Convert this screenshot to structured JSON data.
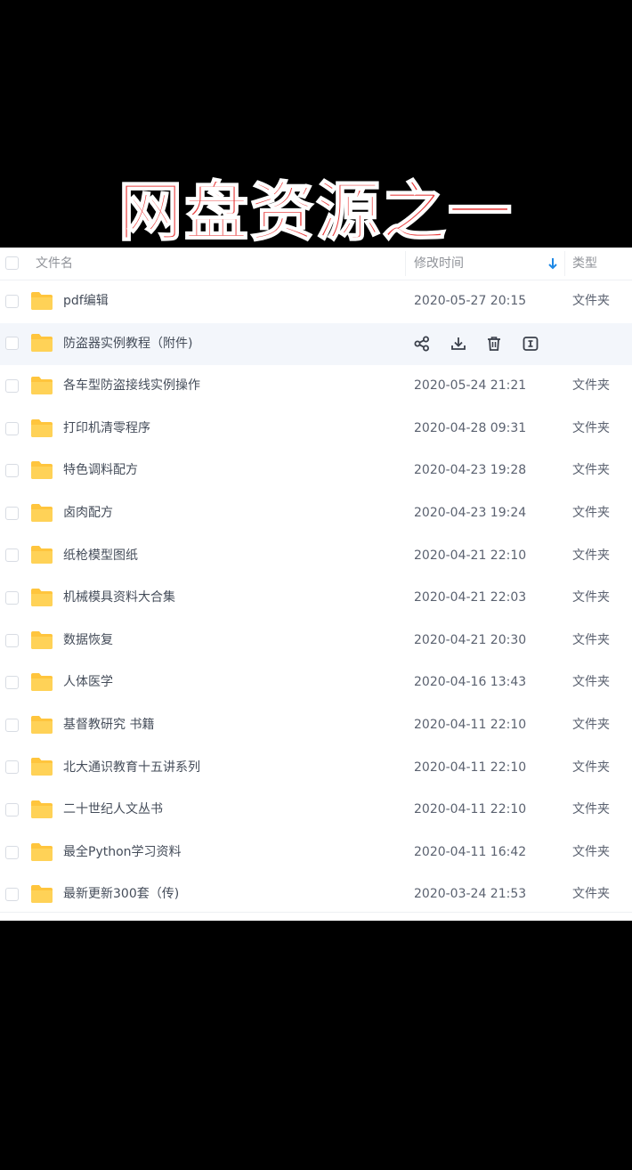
{
  "banner": {
    "title": "网盘资源之一"
  },
  "table": {
    "header": {
      "name": "文件名",
      "time": "修改时间",
      "type": "类型",
      "sort_icon": "arrow-down-icon"
    },
    "rows": [
      {
        "name": "pdf编辑",
        "time": "2020-05-27 20:15",
        "type": "文件夹"
      },
      {
        "name": "防盗器实例教程（附件)",
        "time": "",
        "type": "",
        "hover": true,
        "actions": [
          "share-icon",
          "download-icon",
          "delete-icon",
          "rename-icon"
        ]
      },
      {
        "name": "各车型防盗接线实例操作",
        "time": "2020-05-24 21:21",
        "type": "文件夹"
      },
      {
        "name": "打印机清零程序",
        "time": "2020-04-28 09:31",
        "type": "文件夹"
      },
      {
        "name": "特色调料配方",
        "time": "2020-04-23 19:28",
        "type": "文件夹"
      },
      {
        "name": "卤肉配方",
        "time": "2020-04-23 19:24",
        "type": "文件夹"
      },
      {
        "name": "纸枪模型图纸",
        "time": "2020-04-21 22:10",
        "type": "文件夹"
      },
      {
        "name": "机械模具资料大合集",
        "time": "2020-04-21 22:03",
        "type": "文件夹"
      },
      {
        "name": "数据恢复",
        "time": "2020-04-21 20:30",
        "type": "文件夹"
      },
      {
        "name": "人体医学",
        "time": "2020-04-16 13:43",
        "type": "文件夹"
      },
      {
        "name": "基督教研究 书籍",
        "time": "2020-04-11 22:10",
        "type": "文件夹"
      },
      {
        "name": "北大通识教育十五讲系列",
        "time": "2020-04-11 22:10",
        "type": "文件夹"
      },
      {
        "name": "二十世纪人文丛书",
        "time": "2020-04-11 22:10",
        "type": "文件夹"
      },
      {
        "name": "最全Python学习资料",
        "time": "2020-04-11 16:42",
        "type": "文件夹"
      },
      {
        "name": "最新更新300套（传)",
        "time": "2020-03-24 21:53",
        "type": "文件夹"
      }
    ]
  },
  "colors": {
    "banner_text": "#e83a3a",
    "folder": "#ffc53d",
    "sort_arrow": "#1e88e5",
    "hover_row": "#f3f6fb"
  }
}
